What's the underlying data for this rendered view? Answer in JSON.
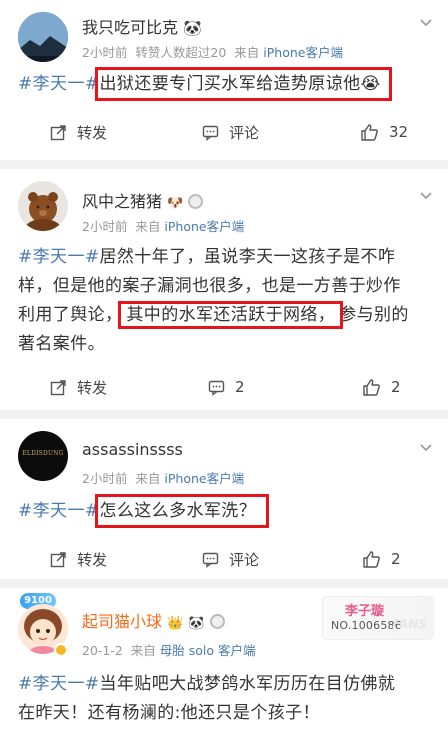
{
  "posts": [
    {
      "username": "我只吃可比克",
      "time": "2小时前",
      "extra": "转赞人数超过20",
      "from": "来自",
      "source": "iPhone客户端",
      "tag": "#李天一#",
      "text_parts": [
        "出狱还要专门买水军给造势原谅他"
      ],
      "emoji": "😭",
      "repost": "转发",
      "comment": "评论",
      "likes": "32"
    },
    {
      "username": "风中之猪猪",
      "time": "2小时前",
      "from": "来自",
      "source": "iPhone客户端",
      "tag": "#李天一#",
      "line1_rest": "居然十年了，虽说李天一这孩子是不咋",
      "line2": "样，但是他的案子漏洞也很多，也是一方善于炒作",
      "line3_pre": "利用了舆论，",
      "line3_hl": "其中的水军还活跃于网络，",
      "line3_post": "参与别的",
      "line4": "著名案件。",
      "repost": "转发",
      "comments": "2",
      "likes": "2"
    },
    {
      "username": "assassinssss",
      "avatar_text": "ELDISDUNG",
      "time": "2小时前",
      "from": "来自",
      "source": "iPhone客户端",
      "tag": "#李天一#",
      "text": "怎么这么多水军洗？",
      "repost": "转发",
      "comment": "评论",
      "likes": "2"
    },
    {
      "username": "起司猫小球",
      "time": "20-1-2",
      "from": "来自",
      "source": "母胎 solo 客户端",
      "badge_top": "9100",
      "tag": "#李天一#",
      "line1_rest": "当年贴吧大战梦鸽水军历历在目仿佛就",
      "line2": "在昨天！还有杨澜的:他还只是个孩子！",
      "vip_name": "李子璇",
      "vip_no": "NO.1006586",
      "vip_fans": "FANS"
    }
  ],
  "colors": {
    "link": "#4a7bb0",
    "highlight_box": "#e8141c",
    "vip_orange": "#f86a1f"
  }
}
